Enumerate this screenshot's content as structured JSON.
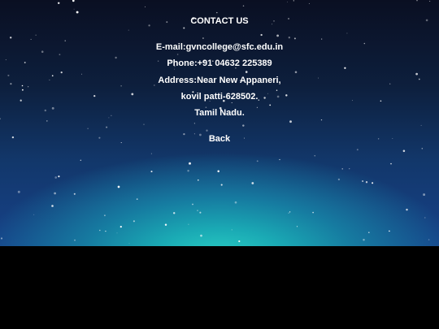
{
  "contact": {
    "title": "CONTACT US",
    "email": "E-mail:gvncollege@sfc.edu.in",
    "phone": "Phone:+91 04632 225389",
    "address": "Address:Near New Appaneri,",
    "city": "kovil patti-628502.",
    "state": "Tamil Nadu.",
    "back_label": "Back"
  },
  "colors": {
    "text": "#ffffff",
    "footer": "#000000",
    "glow": "#2ad0c4"
  }
}
